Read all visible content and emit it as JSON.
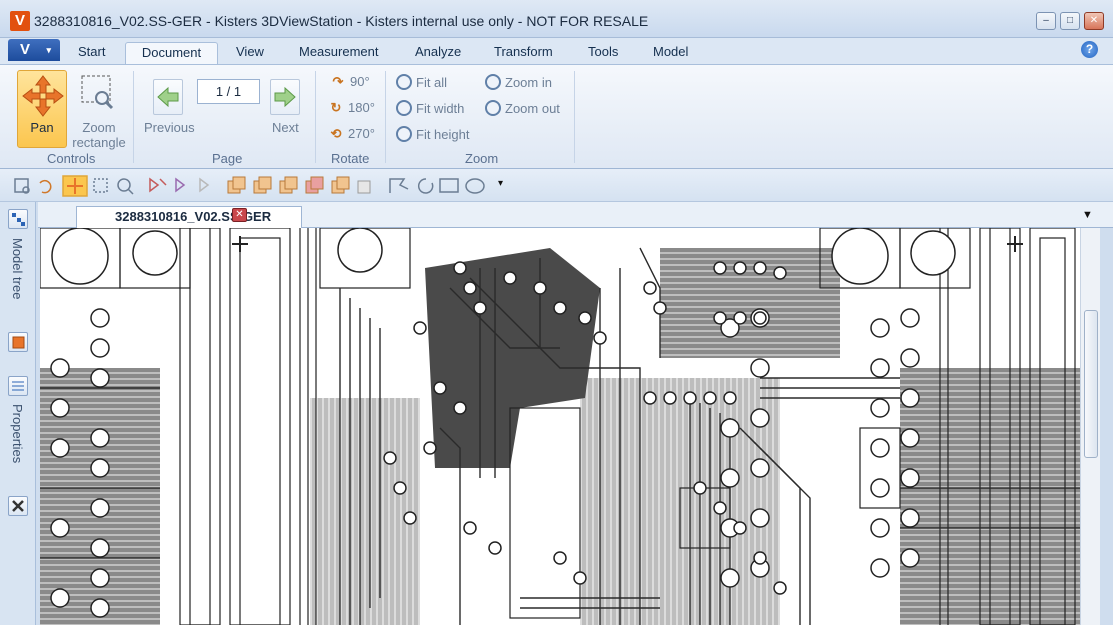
{
  "titlebar": {
    "logo": "V",
    "title": "3288310816_V02.SS-GER - Kisters 3DViewStation - Kisters internal use only - NOT FOR RESALE",
    "minimize": "–",
    "maximize": "□",
    "close": "✕"
  },
  "menu": {
    "app_button": "V",
    "app_chevron": "▾",
    "tabs": [
      {
        "label": "Start"
      },
      {
        "label": "Document",
        "active": true
      },
      {
        "label": "View"
      },
      {
        "label": "Measurement"
      },
      {
        "label": "Analyze"
      },
      {
        "label": "Transform"
      },
      {
        "label": "Tools"
      },
      {
        "label": "Model"
      }
    ],
    "help": "?"
  },
  "ribbon": {
    "controls": {
      "group": "Controls",
      "pan": "Pan",
      "zoom_rect_1": "Zoom",
      "zoom_rect_2": "rectangle"
    },
    "page": {
      "group": "Page",
      "previous": "Previous",
      "next": "Next",
      "page_value": "1 / 1"
    },
    "rotate": {
      "group": "Rotate",
      "r90": "90°",
      "r180": "180°",
      "r270": "270°"
    },
    "zoom": {
      "group": "Zoom",
      "fit_all": "Fit all",
      "fit_width": "Fit width",
      "fit_height": "Fit height",
      "zoom_in": "Zoom in",
      "zoom_out": "Zoom out"
    }
  },
  "side_panel": {
    "model_tree": "Model tree",
    "properties": "Properties"
  },
  "document": {
    "tab_label": "3288310816_V02.SS-GER",
    "close": "✕",
    "menu": "▼"
  },
  "quick_toolbar": {
    "overflow": "▾"
  },
  "colors": {
    "accent": "#fbc64e",
    "ribbon": "#dfe8f4",
    "pcb_copper": "#505050",
    "pcb_hatch": "#7a7a7a"
  }
}
